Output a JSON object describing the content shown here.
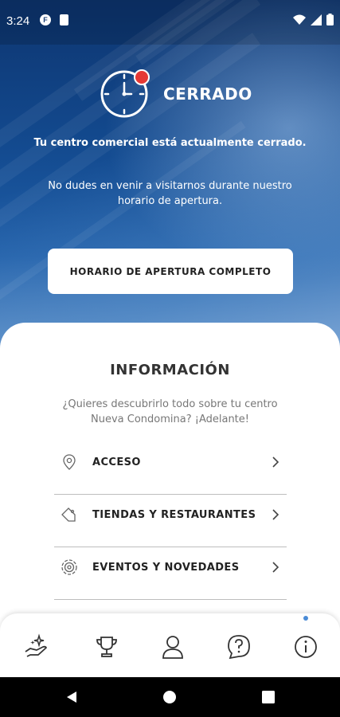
{
  "status_bar": {
    "time": "3:24",
    "icons": [
      "f-app-icon",
      "sd-card-icon",
      "wifi-icon",
      "signal-icon",
      "battery-icon"
    ]
  },
  "hero": {
    "status_title": "CERRADO",
    "message_bold": "Tu centro comercial está actualmente cerrado.",
    "message": "No dudes en venir a visitarnos durante nuestro horario de apertura.",
    "hours_button": "HORARIO DE APERTURA COMPLETO",
    "accent": "#e53935"
  },
  "info": {
    "title": "INFORMACIÓN",
    "subtitle": "¿Quieres descubrirlo todo sobre tu centro Nueva Condomina? ¡Adelante!",
    "items": [
      {
        "label": "ACCESO",
        "icon": "location-pin-icon"
      },
      {
        "label": "TIENDAS Y RESTAURANTES",
        "icon": "tag-icon"
      },
      {
        "label": "EVENTOS Y NOVEDADES",
        "icon": "target-icon"
      }
    ]
  },
  "tabbar": {
    "tabs": [
      "offers-hand-icon",
      "trophy-icon",
      "profile-icon",
      "help-icon",
      "info-icon"
    ],
    "active_tab": "info-icon",
    "active_color": "#4a8bd6"
  },
  "navbar": {
    "buttons": [
      "back-icon",
      "home-icon",
      "recents-icon"
    ]
  }
}
